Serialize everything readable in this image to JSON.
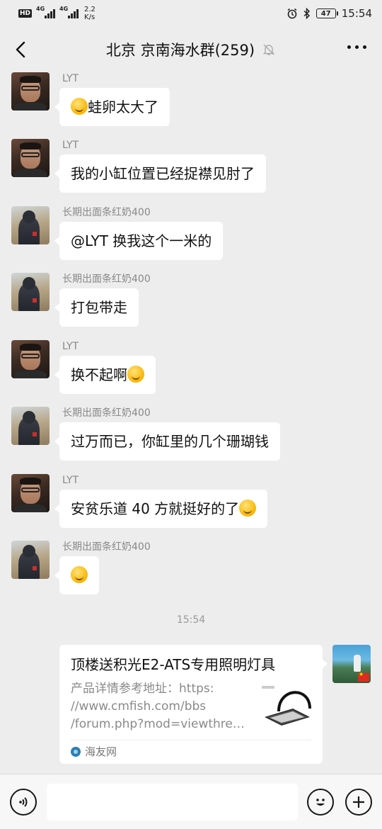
{
  "status_bar": {
    "hd": "HD",
    "net1": "4G",
    "net2": "4G",
    "speed_value": "2.2",
    "speed_unit": "K/s",
    "battery": "47",
    "time": "15:54"
  },
  "header": {
    "title": "北京 京南海水群(259)"
  },
  "messages": [
    {
      "sender": "LYT",
      "text": "蛙卵太大了",
      "emoji_before": true,
      "emoji_after": false
    },
    {
      "sender": "LYT",
      "text": "我的小缸位置已经捉襟见肘了"
    },
    {
      "sender": "长期出面条红奶400",
      "text": "@LYT 换我这个一米的"
    },
    {
      "sender": "长期出面条红奶400",
      "text": "打包带走"
    },
    {
      "sender": "LYT",
      "text": "换不起啊",
      "emoji_after": true
    },
    {
      "sender": "长期出面条红奶400",
      "text": "过万而已，你缸里的几个珊瑚钱"
    },
    {
      "sender": "LYT",
      "text": "安贫乐道 40 方就挺好的了",
      "emoji_after": true
    },
    {
      "sender": "长期出面条红奶400",
      "text": "",
      "emoji_only": true
    }
  ],
  "timestamp": "15:54",
  "link_card": {
    "title": "顶楼送积光E2-ATS专用照明灯具",
    "desc_lines": [
      "产品详情参考地址：https:",
      "//www.cmfish.com/bbs",
      "/forum.php?mod=viewthrea..."
    ],
    "source": "海友网"
  },
  "colors": {
    "background": "#ededed",
    "bubble": "#ffffff",
    "sender_text": "#888888"
  }
}
